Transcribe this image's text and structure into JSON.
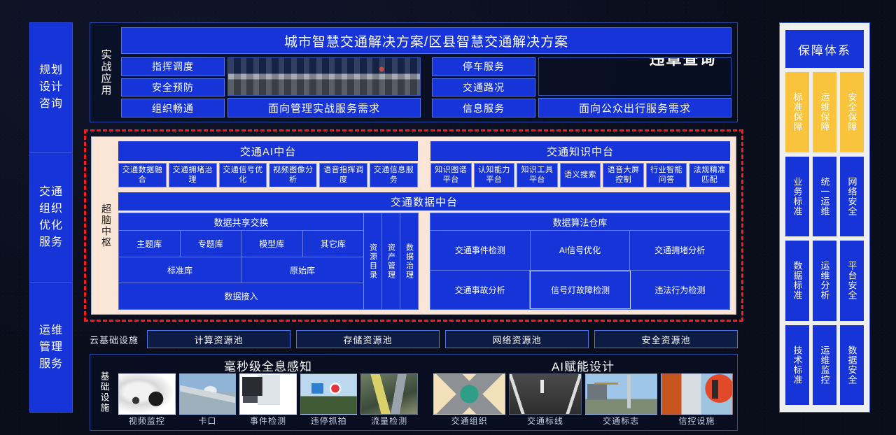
{
  "left_rail": {
    "segments": [
      "规划设计咨询",
      "交通组织优化服务",
      "运维管理服务"
    ]
  },
  "application": {
    "side_label": "实战应用",
    "title": "城市智慧交通解决方案/区县智慧交通解决方案",
    "left": {
      "chips": [
        "指挥调度",
        "安全预防",
        "组织畅通"
      ],
      "caption": "面向管理实战服务需求",
      "image": "traffic-command-center-photo"
    },
    "right": {
      "chips": [
        "停车服务",
        "交通路况",
        "信息服务"
      ],
      "caption": "面向公众出行服务需求",
      "image_left": "government-service-web-screenshot",
      "image_right": "violation-inquiry-app-banner"
    }
  },
  "brain": {
    "side_label": "超脑中枢",
    "ai_platform": {
      "title": "交通AI中台",
      "items": [
        "交通数据融合",
        "交通拥堵治理",
        "交通信号优化",
        "视频图像分析",
        "语音指挥调度",
        "交通信息服务"
      ],
      "highlight_index": 3
    },
    "knowledge_platform": {
      "title": "交通知识中台",
      "items": [
        "知识图谱平台",
        "认知能力平台",
        "知识工具平台",
        "语义搜索",
        "语音大屏控制",
        "行业智能问答",
        "法规精准匹配"
      ],
      "highlight_index": 6
    },
    "data_platform": {
      "title": "交通数据中台",
      "exchange": {
        "title": "数据共享交换",
        "row1": [
          "主题库",
          "专题库",
          "模型库",
          "其它库"
        ],
        "row2": [
          "标准库",
          "原始库"
        ],
        "row3": [
          "数据接入"
        ],
        "side": [
          "资源目录",
          "资产管理",
          "数据治理"
        ]
      },
      "algorithms": {
        "title": "数据算法仓库",
        "row1": [
          "交通事件检测",
          "AI信号优化",
          "交通拥堵分析"
        ],
        "row2": [
          "交通事故分析",
          "信号灯故障检测",
          "违法行为检测"
        ],
        "highlight_cell": "信号灯故障检测"
      }
    }
  },
  "cloud": {
    "label": "云基础设施",
    "pools": [
      "计算资源池",
      "存储资源池",
      "网络资源池",
      "安全资源池"
    ]
  },
  "infrastructure": {
    "side_label": "基础设施",
    "groups": [
      {
        "title": "毫秒级全息感知",
        "items": [
          {
            "caption": "视频监控",
            "image": "ptz-dome-camera-photo"
          },
          {
            "caption": "卡口",
            "image": "roadside-bayonet-camera-photo"
          },
          {
            "caption": "事件检测",
            "image": "detection-equipment-cabinet-photo"
          },
          {
            "caption": "违停抓拍",
            "image": "no-parking-sign-camera-photo"
          },
          {
            "caption": "流量检测",
            "image": "road-traffic-flow-photo"
          }
        ]
      },
      {
        "title": "AI赋能设计",
        "items": [
          {
            "caption": "交通组织",
            "image": "intersection-layout-diagram"
          },
          {
            "caption": "交通标线",
            "image": "road-lane-marking-photo"
          },
          {
            "caption": "交通标志",
            "image": "traffic-sign-installation-photo"
          },
          {
            "caption": "信控设施",
            "image": "signal-control-cabinet-photo"
          }
        ]
      }
    ]
  },
  "guarantee": {
    "title": "保障体系",
    "rows": [
      {
        "style": "y",
        "cells": [
          "标准保障",
          "运维保障",
          "安全保障"
        ]
      },
      {
        "style": "b",
        "cells": [
          "业务标准",
          "统一运维",
          "网络安全"
        ]
      },
      {
        "style": "b",
        "cells": [
          "数据标准",
          "运维分析",
          "平台安全"
        ]
      },
      {
        "style": "b",
        "cells": [
          "技术标准",
          "运维监控",
          "数据安全"
        ]
      }
    ]
  },
  "colors": {
    "background": "#0a0d1a",
    "primary_blue": "#1634d8",
    "brain_panel": "#fbe5d6",
    "dashed_border": "#ff1a1a",
    "yellow": "#fac33c",
    "panel_light": "#efefef"
  }
}
